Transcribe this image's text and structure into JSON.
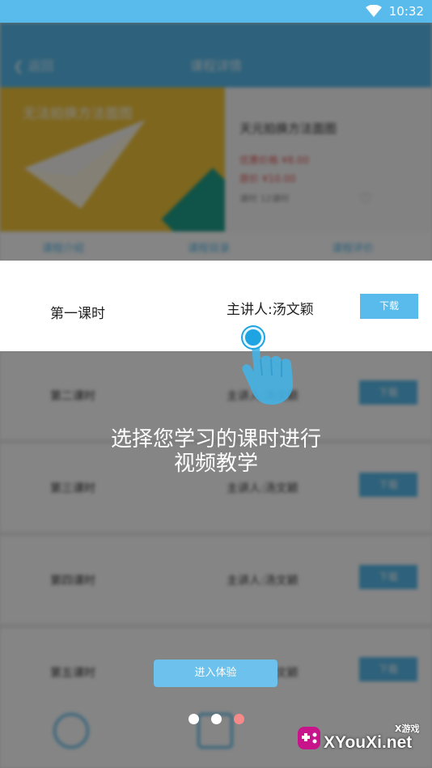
{
  "status_bar": {
    "time": "10:32",
    "wifi_icon": "wifi-icon"
  },
  "background_app": {
    "back_label": "❮ 返回",
    "title": "课程详情",
    "course_thumb_text": "无法拍换方法面图",
    "course_name": "天元拍换方法面图",
    "price_1": "优惠价格 ¥8.00",
    "price_2": "原价 ¥10.00",
    "date": "课时 12课时",
    "tabs": [
      "课程介绍",
      "课程目录",
      "课程评价"
    ],
    "lessons": [
      {
        "name": "第二课时",
        "teacher": "主讲人:汤文颖",
        "button": "下载"
      },
      {
        "name": "第三课时",
        "teacher": "主讲人:汤文颖",
        "button": "下载"
      },
      {
        "name": "第四课时",
        "teacher": "主讲人:汤文颖",
        "button": "下载"
      },
      {
        "name": "第五课时",
        "teacher": "主讲人:汤文颖",
        "button": "下载"
      }
    ]
  },
  "highlight_row": {
    "lesson": "第一课时",
    "teacher": "主讲人:汤文颖",
    "download_label": "下载"
  },
  "guide": {
    "line1": "选择您学习的课时进行",
    "line2": "视频教学"
  },
  "enter_button_label": "进入体验",
  "pagination": {
    "count": 3,
    "active_index": 2,
    "active_color": "#f48a8a",
    "inactive_color": "#ffffff"
  },
  "watermark": {
    "top_text": "X游戏",
    "main_text": "XYouXi.net"
  },
  "colors": {
    "accent": "#58bbeb",
    "tap": "#1ea4e2"
  }
}
